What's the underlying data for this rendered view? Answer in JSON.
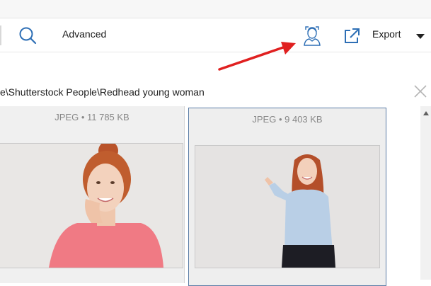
{
  "toolbar": {
    "advanced_label": "Advanced",
    "export_label": "Export",
    "search_icon": "search-icon",
    "face_icon": "face-detection-icon",
    "export_icon": "export-icon",
    "dropdown_icon": "caret-down-icon"
  },
  "path": {
    "text": "e\\Shutterstock People\\Redhead young woman"
  },
  "cards": [
    {
      "label": "JPEG • 11 785 KB",
      "subject": "Redhead woman in pink t-shirt, hand on cheek"
    },
    {
      "label": "JPEG • 9 403 KB",
      "subject": "Redhead woman in blue shirt pointing with thumb"
    }
  ],
  "colors": {
    "accent_blue": "#2e6fb5",
    "annotation_arrow": "#e02020",
    "selected_border": "#5a7ca6"
  }
}
